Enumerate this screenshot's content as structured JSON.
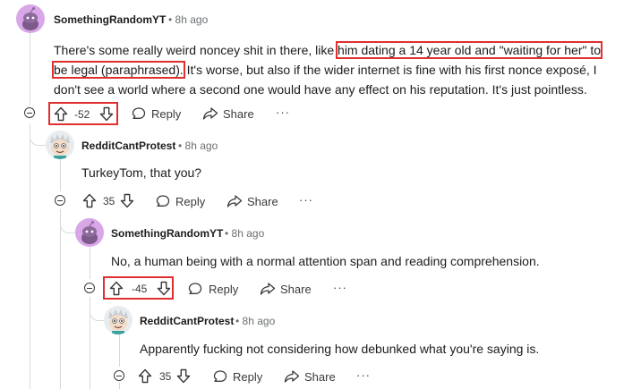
{
  "comments": [
    {
      "author": "SomethingRandomYT",
      "time": "8h ago",
      "body_lines": [
        [
          "There's some really weird noncey shit in there, like ",
          "him dating a 14 year old and \"waiting for her\" to"
        ],
        [
          "be legal (paraphrased).",
          " It's worse, but also if the wider internet is fine with his first nonce exposé, I"
        ],
        [
          "don't see a world where a second one would have any effect on his reputation. It's just pointless."
        ]
      ],
      "score": "-52",
      "reply_label": "Reply",
      "share_label": "Share",
      "more_label": "···"
    },
    {
      "author": "RedditCantProtest",
      "time": "8h ago",
      "body": "TurkeyTom, that you?",
      "score": "35",
      "reply_label": "Reply",
      "share_label": "Share",
      "more_label": "···"
    },
    {
      "author": "SomethingRandomYT",
      "time": "8h ago",
      "body": "No, a human being with a normal attention span and reading comprehension.",
      "score": "-45",
      "reply_label": "Reply",
      "share_label": "Share",
      "more_label": "···"
    },
    {
      "author": "RedditCantProtest",
      "time": "8h ago",
      "body": "Apparently fucking not considering how debunked what you're saying is.",
      "score": "35",
      "reply_label": "Reply",
      "share_label": "Share",
      "more_label": "···"
    }
  ],
  "separator": "•",
  "colors": {
    "highlight": "#e02f2f",
    "thread_line": "#d6d9dc",
    "snoo_avatar_bg": "#d9a6e8",
    "text": "#1c1c1c",
    "meta": "#6b6f72"
  },
  "icons": [
    "snoo-avatar-icon",
    "cartoon-avatar-icon",
    "collapse-icon",
    "upvote-icon",
    "downvote-icon",
    "reply-bubble-icon",
    "share-arrow-icon",
    "more-icon"
  ]
}
